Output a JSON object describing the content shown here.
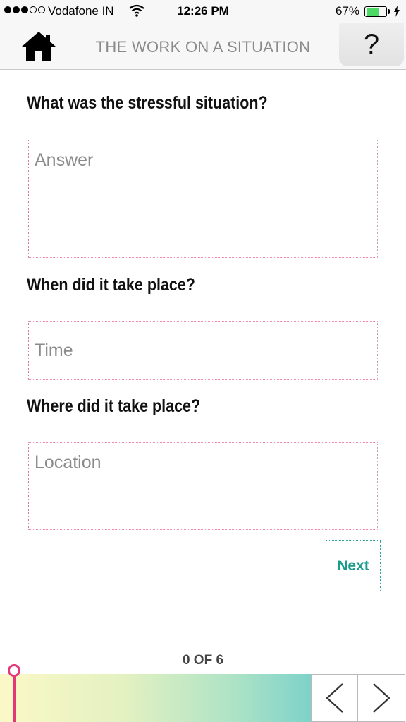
{
  "status_bar": {
    "carrier": "Vodafone IN",
    "time": "12:26 PM",
    "battery": "67%",
    "battery_level": 0.67
  },
  "header": {
    "title": "THE WORK ON A SITUATION",
    "help_label": "?",
    "home_icon": "home-icon"
  },
  "form": {
    "q1": "What was the stressful situation?",
    "q1_placeholder": "Answer",
    "q2": "When did it take place?",
    "q2_placeholder": "Time",
    "q3": "Where did it take place?",
    "q3_placeholder": "Location",
    "next_label": "Next"
  },
  "progress": {
    "label": "0 OF 6",
    "current": 0,
    "total": 6
  },
  "colors": {
    "accent_pink": "#e5367a",
    "accent_teal": "#1c9b8f"
  }
}
